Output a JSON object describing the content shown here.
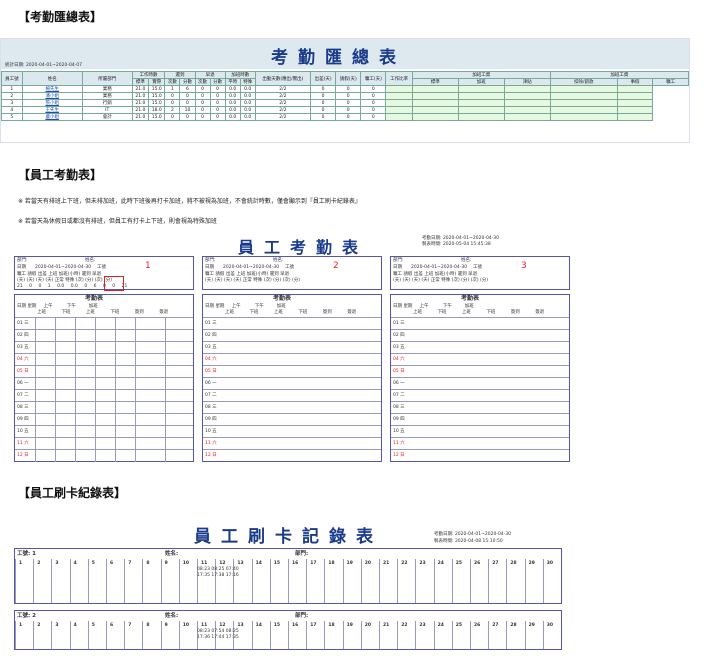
{
  "sec1": {
    "heading": "【考勤匯總表】",
    "title": "考勤匯總表",
    "range": "統計日期: 2020-04-01~2020-04-07",
    "cols": [
      "員工號",
      "姓名",
      "所屬部門",
      "工作時數",
      "遲到",
      "早退",
      "加班時數",
      "出勤天數(應出/實出)",
      "出差(天)",
      "請假(天)",
      "曠工(天)",
      "工作比率",
      "加班工資",
      "加班工資"
    ],
    "sub": [
      "標準",
      "實際",
      "次數",
      "分數",
      "次數",
      "分數",
      "平時",
      "特殊"
    ],
    "sub2": [
      "標準",
      "加班",
      "津貼",
      "扣除/罰款",
      "事假",
      "曠工"
    ],
    "rows": [
      [
        "1",
        "楊先生",
        "業務",
        "21.0",
        "15.0",
        "1",
        "6",
        "0",
        "0",
        "0.0",
        "0.0",
        "2/2",
        "0",
        "0",
        "0"
      ],
      [
        "2",
        "潘小姐",
        "業務",
        "21.0",
        "15.0",
        "0",
        "0",
        "0",
        "0",
        "0.0",
        "0.0",
        "2/2",
        "0",
        "0",
        "0"
      ],
      [
        "3",
        "張小姐",
        "行銷",
        "21.0",
        "15.0",
        "0",
        "0",
        "0",
        "0",
        "0.0",
        "0.0",
        "2/2",
        "0",
        "0",
        "0"
      ],
      [
        "4",
        "王先生",
        "IT",
        "21.0",
        "18.0",
        "2",
        "10",
        "0",
        "0",
        "0.0",
        "0.0",
        "2/2",
        "0",
        "0",
        "0"
      ],
      [
        "5",
        "盧小姐",
        "會計",
        "21.0",
        "15.0",
        "0",
        "0",
        "0",
        "0",
        "0.0",
        "0.0",
        "2/2",
        "0",
        "0",
        "0"
      ]
    ]
  },
  "sec2": {
    "heading": "【員工考勤表】",
    "note1": "※ 若當天有排班上下班，但未排加班，此時下班後再打卡加班，將不被視為加班，不會統計時數，僅會顯示到『員工刷卡紀錄表』",
    "note2": "※ 若當天為休假日或都沒有排班，但員工有打卡上下班，則會視為特殊加班",
    "title": "員工考勤表",
    "print_range": "考勤日期: 2020-04-01~2020-04-30",
    "print_time": "製表時間: 2020-05-04 15:45:38",
    "dept": "部門:",
    "name": "姓名:",
    "date": "日期",
    "range": "2020-04-01~2020-04-30",
    "shift": "工號",
    "labels": [
      "1",
      "2",
      "3"
    ],
    "sum_head": [
      "曠工",
      "請假",
      "出差",
      "上班",
      "加班(小時)",
      "遲到",
      "早退"
    ],
    "sum_units": [
      "(天)",
      "(天)",
      "(天)",
      "(天)",
      "正常",
      "特殊",
      "(次)",
      "(分)",
      "(次)",
      "(分)"
    ],
    "sum_vals": [
      "21",
      "0",
      "0",
      "1",
      "0.0",
      "0.0",
      "0",
      "6",
      "0",
      "0",
      "21"
    ],
    "table_title": "考勤表",
    "day_head": [
      "日期",
      "星期",
      "上午",
      "下午",
      "加班"
    ],
    "in_out": [
      "上班",
      "下班",
      "上班",
      "下班",
      "簽到",
      "簽退"
    ],
    "days": [
      "01 三",
      "02 四",
      "03 五",
      "04 六",
      "05 日",
      "06 一",
      "07 二",
      "08 三",
      "09 四",
      "10 五",
      "11 六",
      "12 日"
    ]
  },
  "sec3": {
    "heading": "【員工刷卡紀錄表】",
    "title": "員工刷卡記錄表",
    "print_range": "考勤日期: 2020-04-01~2020-04-30",
    "print_time": "製表時間: 2020-04-08 15:10:50",
    "emp1": "工號: 1",
    "emp2": "工號: 2",
    "name": "姓名:",
    "dept": "部門:",
    "days": [
      "1",
      "2",
      "3",
      "4",
      "5",
      "6",
      "7",
      "8",
      "9",
      "10",
      "11",
      "12",
      "13",
      "14",
      "15",
      "16",
      "17",
      "18",
      "19",
      "20",
      "21",
      "22",
      "23",
      "24",
      "25",
      "26",
      "27",
      "28",
      "29",
      "30"
    ]
  }
}
